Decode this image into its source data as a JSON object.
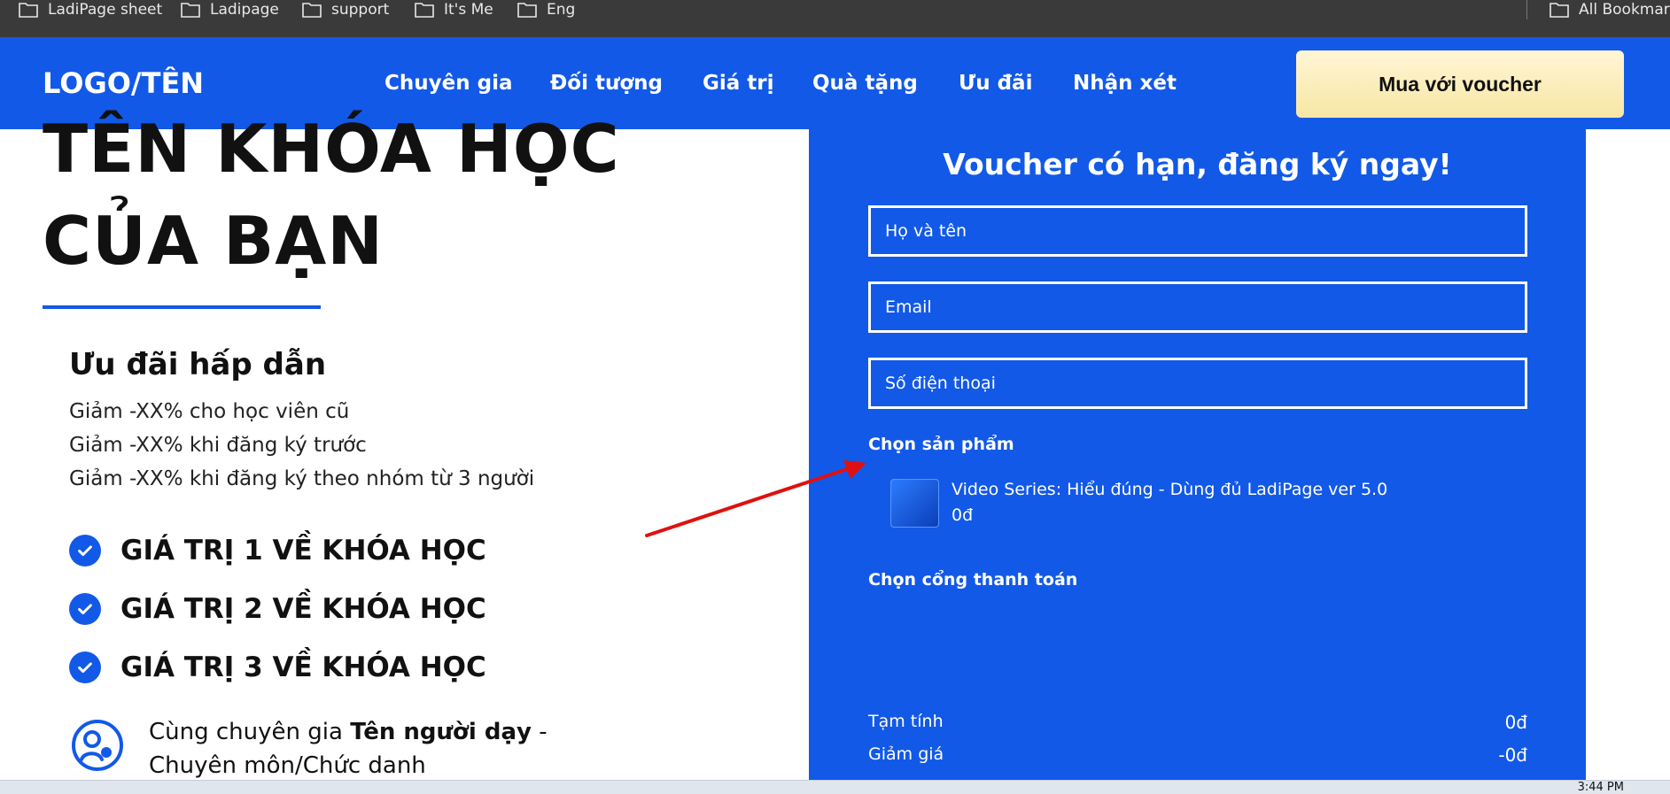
{
  "bookmarks": [
    {
      "label": "LadiPage sheet"
    },
    {
      "label": "Ladipage"
    },
    {
      "label": "support"
    },
    {
      "label": "It's Me"
    },
    {
      "label": "Eng"
    }
  ],
  "bookmarks_all": "All Bookmarks",
  "nav": {
    "logo": "LOGO/TÊN",
    "items": [
      "Chuyên gia",
      "Đối tượng",
      "Giá trị",
      "Quà tặng",
      "Ưu đãi",
      "Nhận xét"
    ],
    "cta_label": "Mua với voucher"
  },
  "hero": {
    "title_line1": "TÊN KHÓA HỌC",
    "title_line2": "CỦA BẠN"
  },
  "offers": {
    "heading": "Ưu đãi hấp dẫn",
    "lines": [
      "Giảm -XX% cho học viên cũ",
      "Giảm -XX% khi đăng ký trước",
      "Giảm -XX% khi đăng ký theo nhóm từ 3 người"
    ]
  },
  "values": [
    "GIÁ TRỊ 1 VỀ KHÓA HỌC",
    "GIÁ TRỊ 2 VỀ KHÓA HỌC",
    "GIÁ TRỊ 3 VỀ KHÓA HỌC"
  ],
  "expert": {
    "prefix": "Cùng chuyên gia ",
    "name": "Tên người dạy",
    "suffix": " -",
    "line2": "Chuyên môn/Chức danh"
  },
  "form": {
    "title": "Voucher có hạn, đăng ký ngay!",
    "fields": {
      "name_placeholder": "Họ và tên",
      "email_placeholder": "Email",
      "phone_placeholder": "Số điện thoại"
    },
    "product_label": "Chọn sản phẩm",
    "product_name": "Video Series: Hiểu đúng - Dùng đủ LadiPage ver 5.0",
    "product_price": "0đ",
    "payment_label": "Chọn cổng thanh toán",
    "subtotal_label": "Tạm tính",
    "subtotal_value": "0đ",
    "discount_label": "Giảm giá",
    "discount_value": "-0đ"
  },
  "taskbar": {
    "clock": "3:44 PM"
  },
  "colors": {
    "brand_blue": "#1259e8",
    "cta_yellow": "#f7e6a4",
    "annotation_red": "#e01010"
  }
}
